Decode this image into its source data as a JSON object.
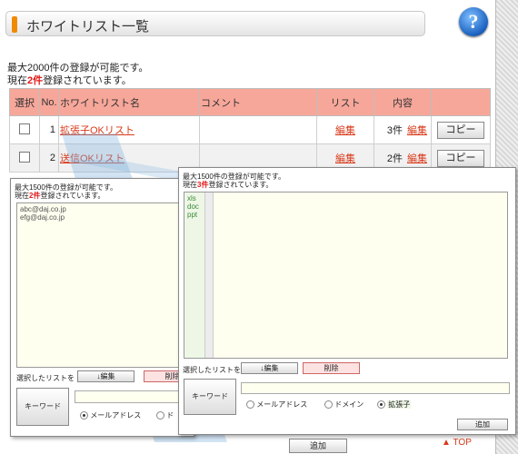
{
  "header": {
    "title": "ホワイトリスト一覧",
    "help_icon": "?"
  },
  "info": {
    "line1": "最大2000件の登録が可能です。",
    "line2_pre": "現在",
    "line2_count": "2件",
    "line2_post": "登録されています。"
  },
  "table": {
    "headers": [
      "選択",
      "No.",
      "ホワイトリスト名",
      "コメント",
      "リスト",
      "内容",
      ""
    ],
    "rows": [
      {
        "no": "1",
        "name": "拡張子OKリスト",
        "comment": "",
        "list_link": "編集",
        "count": "3件",
        "content_link": "編集",
        "copy": "コピー"
      },
      {
        "no": "2",
        "name": "送信OKリスト",
        "comment": "",
        "list_link": "編集",
        "count": "2件",
        "content_link": "編集",
        "copy": "コピー"
      }
    ]
  },
  "left_panel": {
    "info1": "最大1500件の登録が可能です。",
    "info2_pre": "現在",
    "info2_count": "2件",
    "info2_post": "登録されています。",
    "items": [
      "abc@daj.co.jp",
      "efg@daj.co.jp"
    ],
    "selected_label": "選択したリストを",
    "edit_btn": "↓編集",
    "delete_btn": "削除",
    "keyword_btn": "キーワード",
    "radio_mail": "メールアドレス",
    "radio_domain_partial": "ド"
  },
  "right_panel": {
    "info1": "最大1500件の登録が可能です。",
    "info2_pre": "現在",
    "info2_count": "3件",
    "info2_post": "登録されています。",
    "items": [
      "xls",
      "doc",
      "ppt"
    ],
    "selected_label": "選択したリストを",
    "edit_btn": "↓編集",
    "delete_btn": "削除",
    "keyword_btn": "キーワード",
    "radio_mail": "メールアドレス",
    "radio_domain": "ドメイン",
    "radio_ext": "拡張子",
    "add_btn": "追加"
  },
  "bottom": {
    "partial_btn": "追加",
    "top_link": "▲ TOP"
  }
}
